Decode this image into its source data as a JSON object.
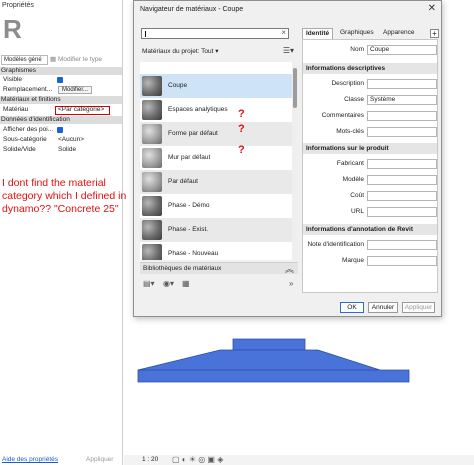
{
  "properties": {
    "title": "Propriétés",
    "type_selector": "Modèles géné",
    "edit_type": "Modifier le type",
    "sections": [
      "Graphismes",
      "Matériaux et finitions",
      "Données d'identification"
    ],
    "rows": {
      "visible": "Visible",
      "replacement": "Remplacement...",
      "replacement_btn": "Modifier...",
      "material": "Matériau",
      "material_value": "<Par catégorie>",
      "show_edges": "Afficher des poi...",
      "subcategory": "Sous-catégorie",
      "subcategory_value": "<Aucun>",
      "solid_void": "Solide/Vide",
      "solid_void_value": "Solide"
    },
    "annotation_lines": [
      "I dont find the material",
      "category which I defined in",
      "dynamo?? \"Concrete 25\""
    ],
    "help_link": "Aide des propriétés",
    "apply": "Appliquer",
    "scale": "1 : 20"
  },
  "dialog": {
    "title": "Navigateur de matériaux - Coupe",
    "close": "✕",
    "project_label": "Matériaux du projet: Tout",
    "materials": [
      {
        "label": "Coupe",
        "selected": true
      },
      {
        "label": "Espaces analytiques"
      },
      {
        "label": "Forme par défaut"
      },
      {
        "label": "Mur par défaut"
      },
      {
        "label": "Par défaut"
      },
      {
        "label": "Phase - Démo"
      },
      {
        "label": "Phase - Exist."
      },
      {
        "label": "Phase - Nouveau"
      }
    ],
    "question_mark": "?",
    "library_bar": "Bibliothèques de matériaux",
    "tabs": [
      "Identité",
      "Graphiques",
      "Apparence"
    ],
    "tab_plus": "+",
    "identity": {
      "name_label": "Nom",
      "name_value": "Coupe",
      "section_desc": "Informations descriptives",
      "description": "Description",
      "class": "Classe",
      "class_value": "Système",
      "comments": "Commentaires",
      "keywords": "Mots-clés",
      "section_product": "Informations sur le produit",
      "manufacturer": "Fabricant",
      "model": "Modèle",
      "cost": "Coût",
      "url": "URL",
      "section_revit": "Informations d'annotation de Revit",
      "keynote": "Note d'identification",
      "mark": "Marque"
    },
    "buttons": {
      "ok": "OK",
      "cancel": "Annuler",
      "apply": "Appliquer"
    }
  },
  "colors": {
    "annotation_red": "#e01010",
    "shape_blue": "#4a73d9",
    "selection_blue": "#cfe3f7"
  }
}
